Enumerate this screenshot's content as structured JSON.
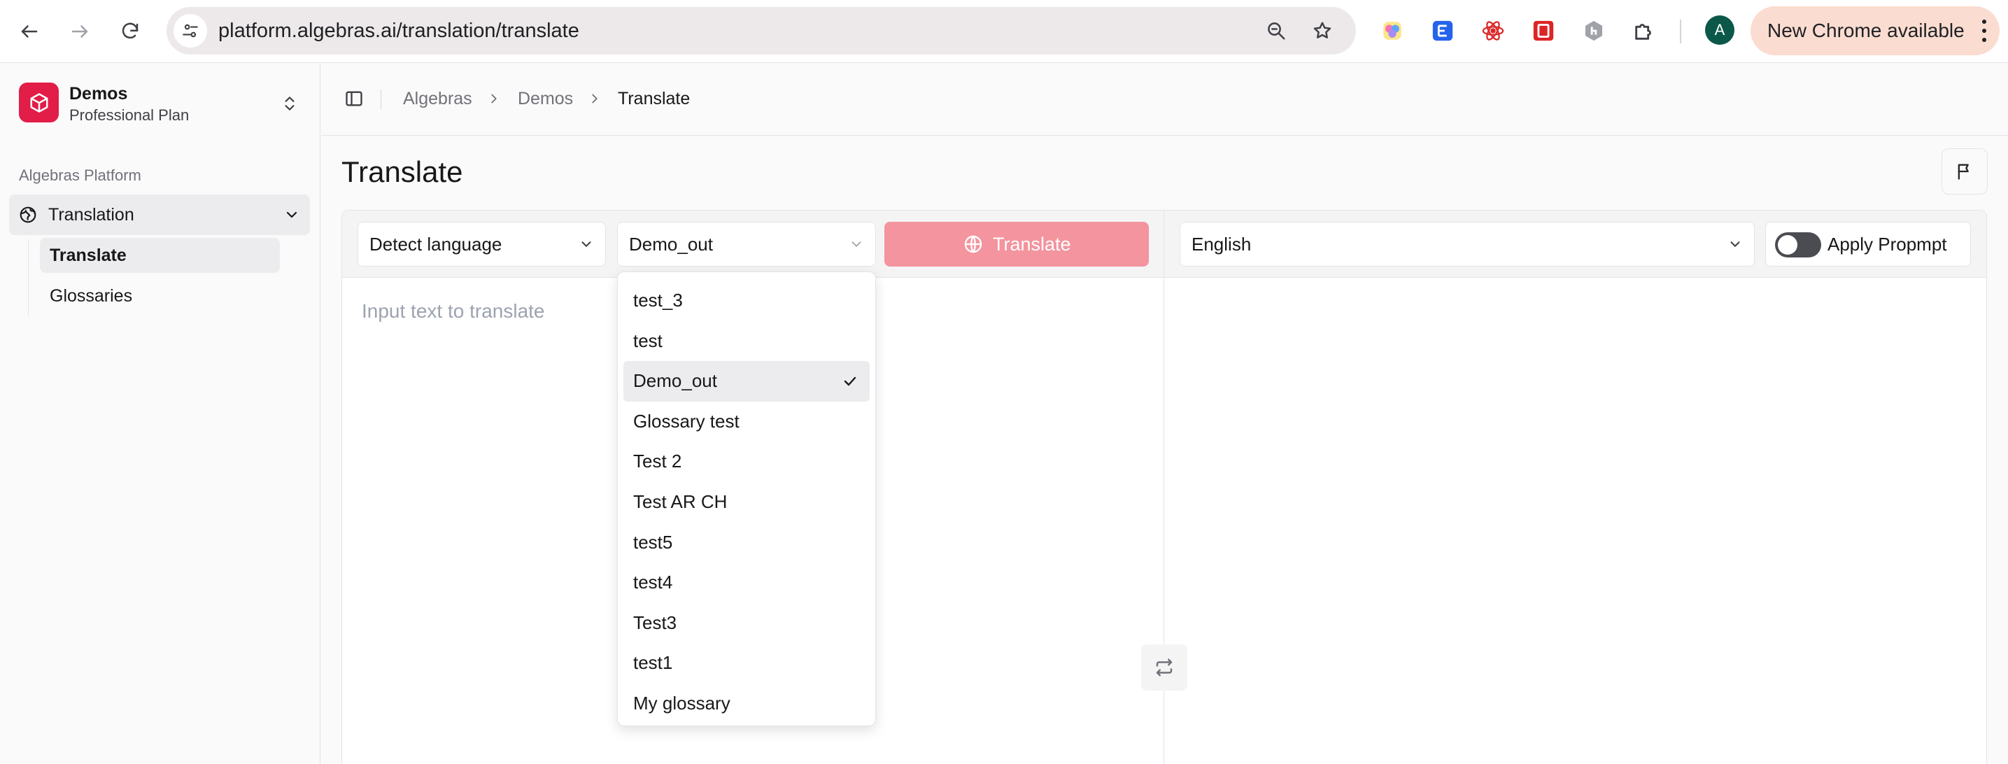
{
  "browser": {
    "url": "platform.algebras.ai/translation/translate",
    "update_label": "New Chrome available",
    "profile_initial": "A"
  },
  "sidebar": {
    "org_name": "Demos",
    "org_plan": "Professional Plan",
    "group_label": "Algebras Platform",
    "nav": {
      "label": "Translation",
      "items": [
        {
          "label": "Translate",
          "active": true
        },
        {
          "label": "Glossaries",
          "active": false
        }
      ]
    }
  },
  "breadcrumbs": [
    "Algebras",
    "Demos",
    "Translate"
  ],
  "page": {
    "title": "Translate"
  },
  "translator": {
    "source_language": "Detect language",
    "glossary": "Demo_out",
    "translate_label": "Translate",
    "target_language": "English",
    "apply_prompt_label": "Apply Propmpt",
    "apply_prompt_on": false,
    "input_placeholder": "Input text to translate"
  },
  "glossary_dropdown": {
    "selected": "Demo_out",
    "options": [
      "test_3",
      "test",
      "Demo_out",
      "Glossary test",
      "Test 2",
      "Test AR CH",
      "test5",
      "test4",
      "Test3",
      "test1",
      "My glossary"
    ]
  },
  "colors": {
    "brand": "#e11d48",
    "translate_button": "#f3949e",
    "update_pill": "#fbdcd0"
  }
}
